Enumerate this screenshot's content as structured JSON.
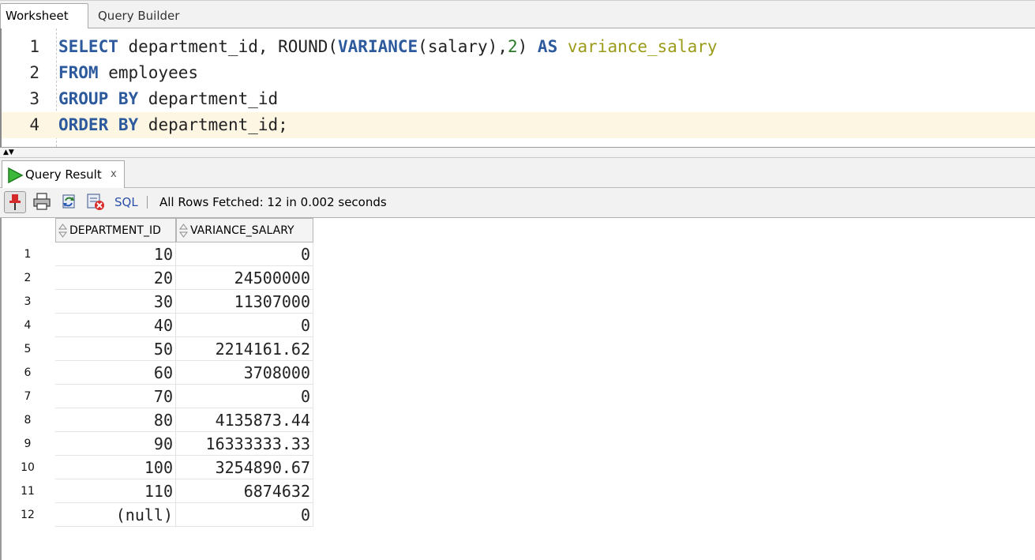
{
  "tabs": {
    "worksheet": "Worksheet",
    "query_builder": "Query Builder"
  },
  "editor": {
    "lines": [
      {
        "num": "1",
        "tokens": [
          {
            "t": "SELECT",
            "k": "kw"
          },
          {
            "t": " department_id, ROUND(",
            "k": "plain"
          },
          {
            "t": "VARIANCE",
            "k": "kw"
          },
          {
            "t": "(salary),",
            "k": "plain"
          },
          {
            "t": "2",
            "k": "num"
          },
          {
            "t": ") ",
            "k": "plain"
          },
          {
            "t": "AS",
            "k": "kw"
          },
          {
            "t": " ",
            "k": "plain"
          },
          {
            "t": "variance_salary",
            "k": "alias"
          }
        ]
      },
      {
        "num": "2",
        "tokens": [
          {
            "t": "FROM",
            "k": "kw"
          },
          {
            "t": " employees",
            "k": "plain"
          }
        ]
      },
      {
        "num": "3",
        "tokens": [
          {
            "t": "GROUP BY",
            "k": "kw"
          },
          {
            "t": " department_id",
            "k": "plain"
          }
        ]
      },
      {
        "num": "4",
        "tokens": [
          {
            "t": "ORDER BY",
            "k": "kw"
          },
          {
            "t": " department_id;",
            "k": "plain"
          }
        ]
      }
    ],
    "current_line": 4
  },
  "result_panel": {
    "tab_label": "Query Result",
    "close_glyph": "x",
    "toolbar": {
      "sql_label": "SQL",
      "status": "All Rows Fetched: 12 in 0.002 seconds"
    },
    "columns": [
      "DEPARTMENT_ID",
      "VARIANCE_SALARY"
    ],
    "rows": [
      {
        "n": "1",
        "dept": "10",
        "var": "0"
      },
      {
        "n": "2",
        "dept": "20",
        "var": "24500000"
      },
      {
        "n": "3",
        "dept": "30",
        "var": "11307000"
      },
      {
        "n": "4",
        "dept": "40",
        "var": "0"
      },
      {
        "n": "5",
        "dept": "50",
        "var": "2214161.62"
      },
      {
        "n": "6",
        "dept": "60",
        "var": "3708000"
      },
      {
        "n": "7",
        "dept": "70",
        "var": "0"
      },
      {
        "n": "8",
        "dept": "80",
        "var": "4135873.44"
      },
      {
        "n": "9",
        "dept": "90",
        "var": "16333333.33"
      },
      {
        "n": "10",
        "dept": "100",
        "var": "3254890.67"
      },
      {
        "n": "11",
        "dept": "110",
        "var": "6874632"
      },
      {
        "n": "12",
        "dept": "(null)",
        "var": "0"
      }
    ]
  },
  "icons": {
    "run": "play-icon",
    "pin": "pin-icon",
    "print": "print-icon",
    "refresh": "refresh-icon",
    "cancel": "cancel-icon",
    "sort": "sort-icon"
  },
  "colors": {
    "keyword": "#2c5a9c",
    "number": "#2a7a2a",
    "alias": "#9b9b1a",
    "current_line": "#fdf6e2",
    "run_green": "#2fa52f"
  }
}
